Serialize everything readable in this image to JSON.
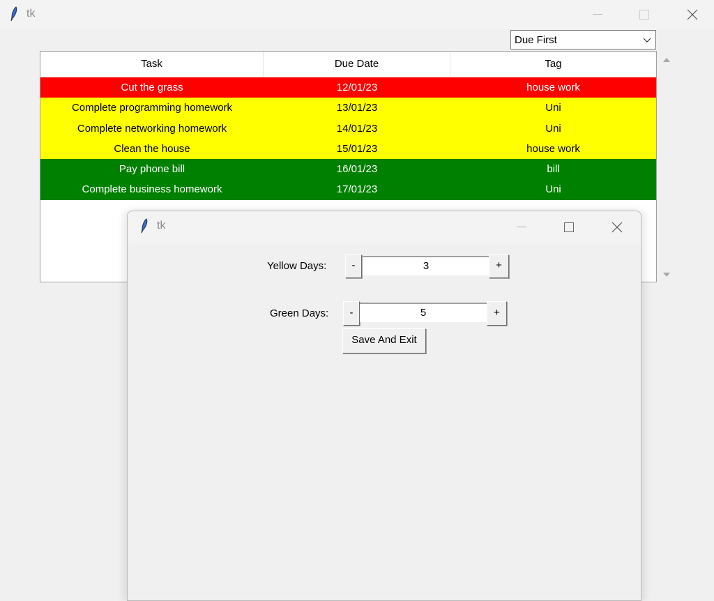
{
  "main_window": {
    "title": "tk",
    "icon": "feather-icon",
    "controls": {
      "minimize": "minimize-icon",
      "maximize": "maximize-icon",
      "close": "close-icon"
    }
  },
  "sort_select": {
    "value": "Due First"
  },
  "table": {
    "columns": [
      "Task",
      "Due Date",
      "Tag"
    ],
    "rows": [
      {
        "task": "Cut the grass",
        "due": "12/01/23",
        "tag": "house work",
        "bg": "#ff0000",
        "fg": "#ffffff"
      },
      {
        "task": "Complete programming homework",
        "due": "13/01/23",
        "tag": "Uni",
        "bg": "#ffff00",
        "fg": "#000000"
      },
      {
        "task": "Complete networking homework",
        "due": "14/01/23",
        "tag": "Uni",
        "bg": "#ffff00",
        "fg": "#000000"
      },
      {
        "task": "Clean the house",
        "due": "15/01/23",
        "tag": "house work",
        "bg": "#ffff00",
        "fg": "#000000"
      },
      {
        "task": "Pay phone bill",
        "due": "16/01/23",
        "tag": "bill",
        "bg": "#008000",
        "fg": "#ffffff"
      },
      {
        "task": "Complete business homework",
        "due": "17/01/23",
        "tag": "Uni",
        "bg": "#008000",
        "fg": "#ffffff"
      }
    ]
  },
  "settings_dialog": {
    "title": "tk",
    "yellow_days": {
      "label": "Yellow Days:",
      "value": "3",
      "dec": "-",
      "inc": "+"
    },
    "green_days": {
      "label": "Green Days:",
      "value": "5",
      "dec": "-",
      "inc": "+"
    },
    "save_button": "Save And Exit"
  }
}
